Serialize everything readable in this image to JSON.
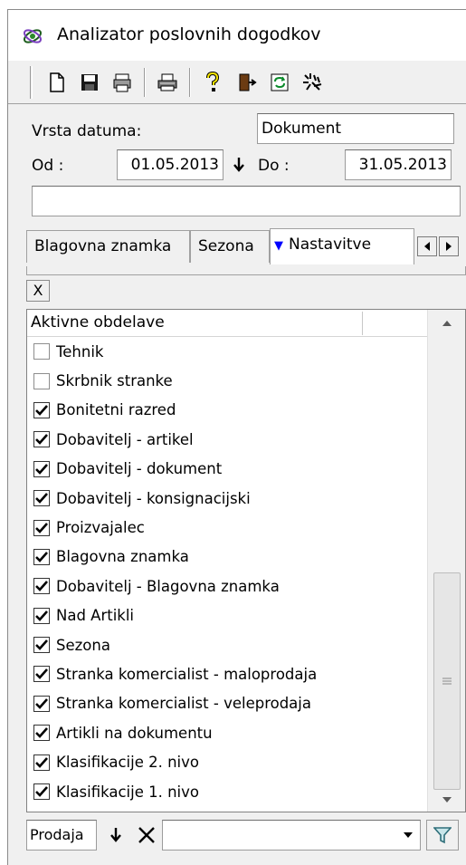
{
  "window": {
    "title": "Analizator poslovnih dogodkov",
    "title_icon": "app-icon"
  },
  "toolbar": {
    "buttons": [
      {
        "icon": "new-document-icon"
      },
      {
        "icon": "save-icon"
      },
      {
        "icon": "print-preview-icon"
      },
      {
        "icon": "print-icon"
      },
      {
        "icon": "help-icon"
      },
      {
        "icon": "exit-door-icon"
      },
      {
        "icon": "refresh-icon"
      },
      {
        "icon": "settings-icon"
      }
    ]
  },
  "filters": {
    "date_type_label": "Vrsta datuma:",
    "date_type_value": "Dokument",
    "from_label": "Od :",
    "from_value": "01.05.2013",
    "to_label": "Do :",
    "to_value": "31.05.2013",
    "search_value": ""
  },
  "tabs": [
    {
      "label": "Blagovna znamka",
      "active": false
    },
    {
      "label": "Sezona",
      "active": false
    },
    {
      "label": "Nastavitve",
      "active": true,
      "marker": "▼"
    }
  ],
  "clear_button": "X",
  "list": {
    "header": "Aktivne obdelave",
    "items": [
      {
        "label": "Tehnik",
        "checked": false
      },
      {
        "label": "Skrbnik stranke",
        "checked": false
      },
      {
        "label": "Bonitetni razred",
        "checked": true
      },
      {
        "label": "Dobavitelj - artikel",
        "checked": true
      },
      {
        "label": "Dobavitelj - dokument",
        "checked": true
      },
      {
        "label": "Dobavitelj - konsignacijski",
        "checked": true
      },
      {
        "label": "Proizvajalec",
        "checked": true
      },
      {
        "label": "Blagovna znamka",
        "checked": true
      },
      {
        "label": "Dobavitelj - Blagovna znamka",
        "checked": true
      },
      {
        "label": "Nad Artikli",
        "checked": true
      },
      {
        "label": "Sezona",
        "checked": true
      },
      {
        "label": "Stranka komercialist - maloprodaja",
        "checked": true
      },
      {
        "label": "Stranka komercialist - veleprodaja",
        "checked": true
      },
      {
        "label": "Artikli na dokumentu",
        "checked": true
      },
      {
        "label": "Klasifikacije 2. nivo",
        "checked": true
      },
      {
        "label": "Klasifikacije 1. nivo",
        "checked": true
      }
    ]
  },
  "bottom": {
    "mode_value": "Prodaja",
    "combo_value": ""
  },
  "colors": {
    "window_bg": "#f0f0f0",
    "accent_blue": "#0000ff",
    "filter_icon": "#2f6f7a"
  }
}
